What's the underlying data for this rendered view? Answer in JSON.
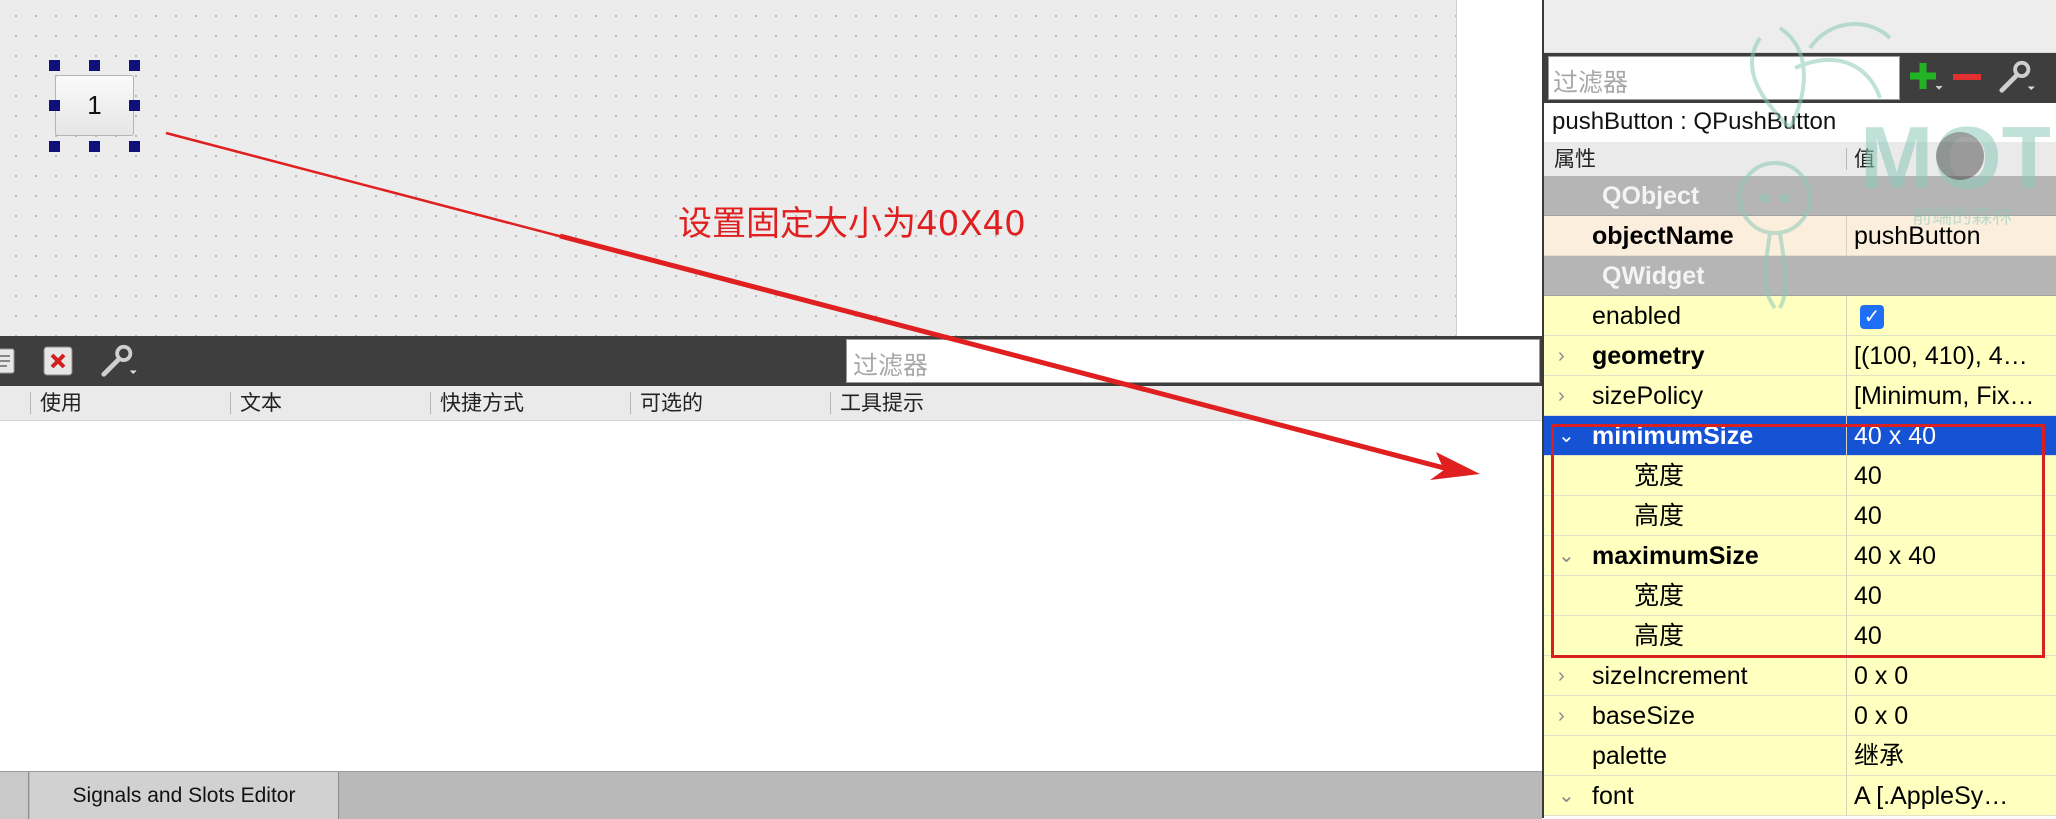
{
  "canvas": {
    "button_text": "1"
  },
  "annotation": {
    "text": "设置固定大小为40X40",
    "color": "#e02020"
  },
  "action_editor": {
    "filter_placeholder": "过滤器",
    "columns": [
      "使用",
      "文本",
      "快捷方式",
      "可选的",
      "工具提示"
    ],
    "toolbar_icons": [
      "document-icon",
      "delete-icon",
      "wrench-icon"
    ]
  },
  "bottom_tabs": {
    "signals_slots": "Signals and Slots Editor"
  },
  "property_editor": {
    "filter_placeholder": "过滤器",
    "object_class": "pushButton : QPushButton",
    "header": {
      "property": "属性",
      "value": "值"
    },
    "toolbar_icons": [
      "add-icon",
      "remove-icon",
      "wrench-icon"
    ],
    "rows": [
      {
        "type": "group",
        "name": "QObject"
      },
      {
        "type": "prop",
        "name": "objectName",
        "value": "pushButton",
        "bold": true,
        "style": "pink"
      },
      {
        "type": "group",
        "name": "QWidget"
      },
      {
        "type": "prop",
        "name": "enabled",
        "checkbox": true
      },
      {
        "type": "prop",
        "name": "geometry",
        "value": "[(100, 410), 4…",
        "bold": true,
        "expander": "›"
      },
      {
        "type": "prop",
        "name": "sizePolicy",
        "value": "[Minimum, Fix…",
        "expander": "›"
      },
      {
        "type": "prop",
        "name": "minimumSize",
        "value": "40 x 40",
        "bold": true,
        "expander": "⌄",
        "selected": true
      },
      {
        "type": "sub",
        "name": "宽度",
        "value": "40"
      },
      {
        "type": "sub",
        "name": "高度",
        "value": "40"
      },
      {
        "type": "prop",
        "name": "maximumSize",
        "value": "40 x 40",
        "bold": true,
        "expander": "⌄"
      },
      {
        "type": "sub",
        "name": "宽度",
        "value": "40"
      },
      {
        "type": "sub",
        "name": "高度",
        "value": "40"
      },
      {
        "type": "prop",
        "name": "sizeIncrement",
        "value": "0 x 0",
        "expander": "›"
      },
      {
        "type": "prop",
        "name": "baseSize",
        "value": "0 x 0",
        "expander": "›"
      },
      {
        "type": "prop",
        "name": "palette",
        "value": "继承"
      },
      {
        "type": "prop",
        "name": "font",
        "value": "A  [.AppleSy…",
        "expander": "⌄"
      }
    ]
  },
  "watermark": {
    "text": "MOT",
    "subtitle": "前端的森林"
  },
  "colors": {
    "selection": "#1652d4",
    "highlight_box": "#d82020",
    "group_row": "#b5b5b5",
    "prop_row": "#ffffc0"
  }
}
